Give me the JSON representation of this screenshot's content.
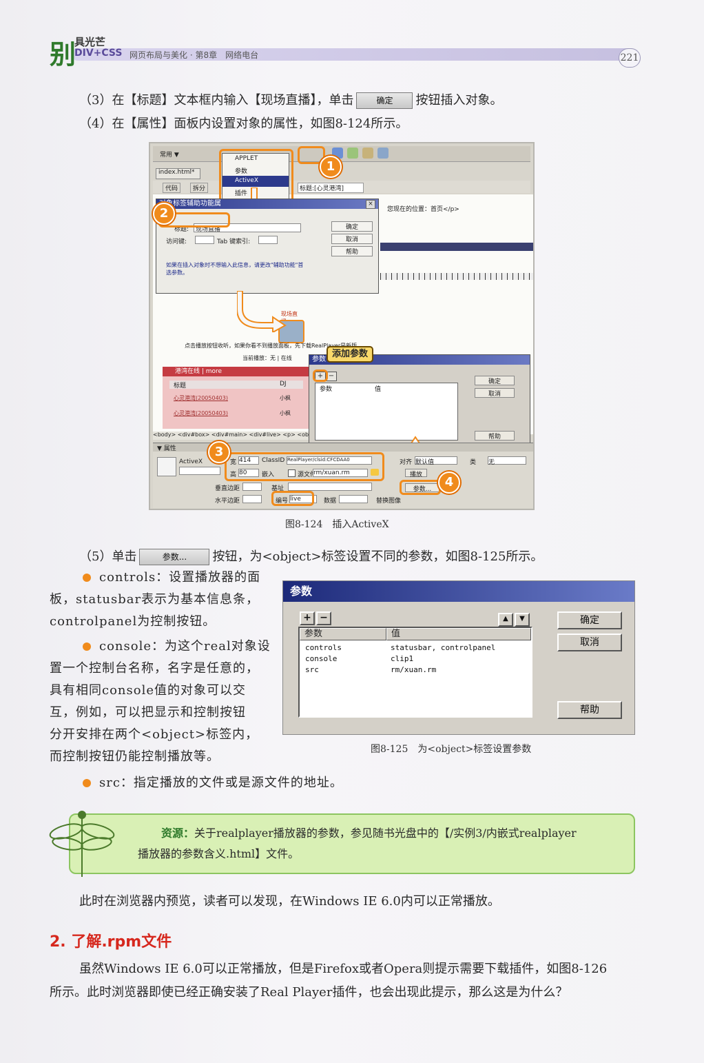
{
  "header": {
    "logo_big": "别",
    "logo_small": "具光芒",
    "css_label": "DIV+CSS",
    "subtitle": "网页布局与美化 · 第8章　网络电台",
    "page_number": "221"
  },
  "steps": {
    "step3_pre": "（3）在【标题】文本框内输入【现场直播】，单击",
    "step3_button": "确定",
    "step3_post": "按钮插入对象。",
    "step4": "（4）在【属性】面板内设置对象的属性，如图8-124所示。",
    "step5_pre": "（5）单击",
    "step5_button": "参数...",
    "step5_post": "按钮，为<object>标签设置不同的参数，如图8-125所示。"
  },
  "fig124": {
    "caption": "图8-124　插入ActiveX",
    "toolbar_common": "常用 ▼",
    "menu_items": [
      "APPLET",
      "参数",
      "ActiveX",
      "插件"
    ],
    "tab_file": "index.html*",
    "view_buttons": [
      "代码",
      "拆分"
    ],
    "title_field": "标题:[心灵港湾]",
    "location": "您现在的位置：首页</p>",
    "dialog_title": "对象标签辅助功能属",
    "label_title": "标题:",
    "title_value": "现场直播",
    "label_access": "访问键:",
    "label_tab": "Tab 键索引:",
    "dialog_buttons": [
      "确定",
      "取消",
      "帮助"
    ],
    "note": "如果在插入对象时不想输入此信息，请更改\"辅助功能\"首选参数。",
    "note_link": "请更改",
    "live_label": "现场直播",
    "player_hint": "点击播放按钮收听，如果你看不到播放面板，先下载RealPlayer是新版。",
    "now_playing": "当前播放：无 | 在线",
    "panel_title": "港湾在线",
    "panel_more": "| more",
    "table_headers": [
      "标题",
      "DJ"
    ],
    "table_rows": [
      [
        "心灵港湾(20050403)",
        "小枫"
      ],
      [
        "心灵港湾(20050403)",
        "小枫"
      ]
    ],
    "tag_path": "<body> <div#box> <div#main> <div#live> <p> <object>",
    "add_param_label": "添加参数",
    "small_param_dialog": "参数",
    "small_cols": [
      "参数",
      "值"
    ],
    "small_buttons": [
      "确定",
      "取消",
      "帮助"
    ],
    "props_title": "▼ 属性",
    "props_type": "ActiveX",
    "props_width_label": "宽",
    "props_width": "414",
    "props_classid_label": "ClassID",
    "props_classid": "RealPlayer/clsid:CFCDAA0",
    "props_height_label": "高",
    "props_height": "80",
    "props_embed": "嵌入",
    "props_source_label": "源文件",
    "props_source": "rm/xuan.rm",
    "props_align_label": "对齐",
    "props_align": "默认值",
    "props_class_label": "类",
    "props_class": "无",
    "props_vspace": "垂直边距",
    "props_hspace": "水平边距",
    "props_base": "基址",
    "props_id_label": "编号",
    "props_id": "live",
    "props_data": "数据",
    "props_alt": "替换图像",
    "props_play": "播放",
    "props_param_button": "参数...",
    "callouts": [
      "1",
      "2",
      "3",
      "4"
    ]
  },
  "bullets": {
    "controls": "controls：设置播放器的面板，statusbar表示为基本信息条，controlpanel为控制按钮。",
    "controls_lines": [
      "controls：设置播放器的面",
      "板，statusbar表示为基本信息条，",
      "controlpanel为控制按钮。"
    ],
    "console_lines": [
      "console：为这个real对象设",
      "置一个控制台名称，名字是任意的，",
      "具有相同console值的对象可以交",
      "互，例如，可以把显示和控制按钮",
      "分开安排在两个<object>标签内，",
      "而控制按钮仍能控制播放等。"
    ],
    "src": "src：指定播放的文件或是源文件的地址。"
  },
  "fig125": {
    "title": "参数",
    "col_param": "参数",
    "col_value": "值",
    "rows": [
      {
        "param": "controls",
        "value": "statusbar, controlpanel"
      },
      {
        "param": "console",
        "value": "clip1"
      },
      {
        "param": "src",
        "value": "rm/xuan.rm"
      }
    ],
    "btn_ok": "确定",
    "btn_cancel": "取消",
    "btn_help": "帮助",
    "plus": "+",
    "minus": "−",
    "up": "▲",
    "down": "▼",
    "caption": "图8-125　为<object>标签设置参数"
  },
  "resource": {
    "label": "资源：",
    "line1": "关于realplayer播放器的参数，参见随书光盘中的【/实例3/内嵌式realplayer",
    "line2": "播放器的参数含义.html】文件。"
  },
  "after_resource": "此时在浏览器内预览，读者可以发现，在Windows IE 6.0内可以正常播放。",
  "section2": {
    "title": "2. 了解.rpm文件",
    "para_line1": "虽然Windows IE 6.0可以正常播放，但是Firefox或者Opera则提示需要下载插件，如图8-126",
    "para_line2": "所示。此时浏览器即使已经正确安装了Real Player插件，也会出现此提示，那么这是为什么？"
  },
  "colors": {
    "accent_orange": "#f08b1c",
    "title_green": "#2f7a2b",
    "section_red": "#d6281e",
    "resource_bg": "#d9f0b5"
  }
}
